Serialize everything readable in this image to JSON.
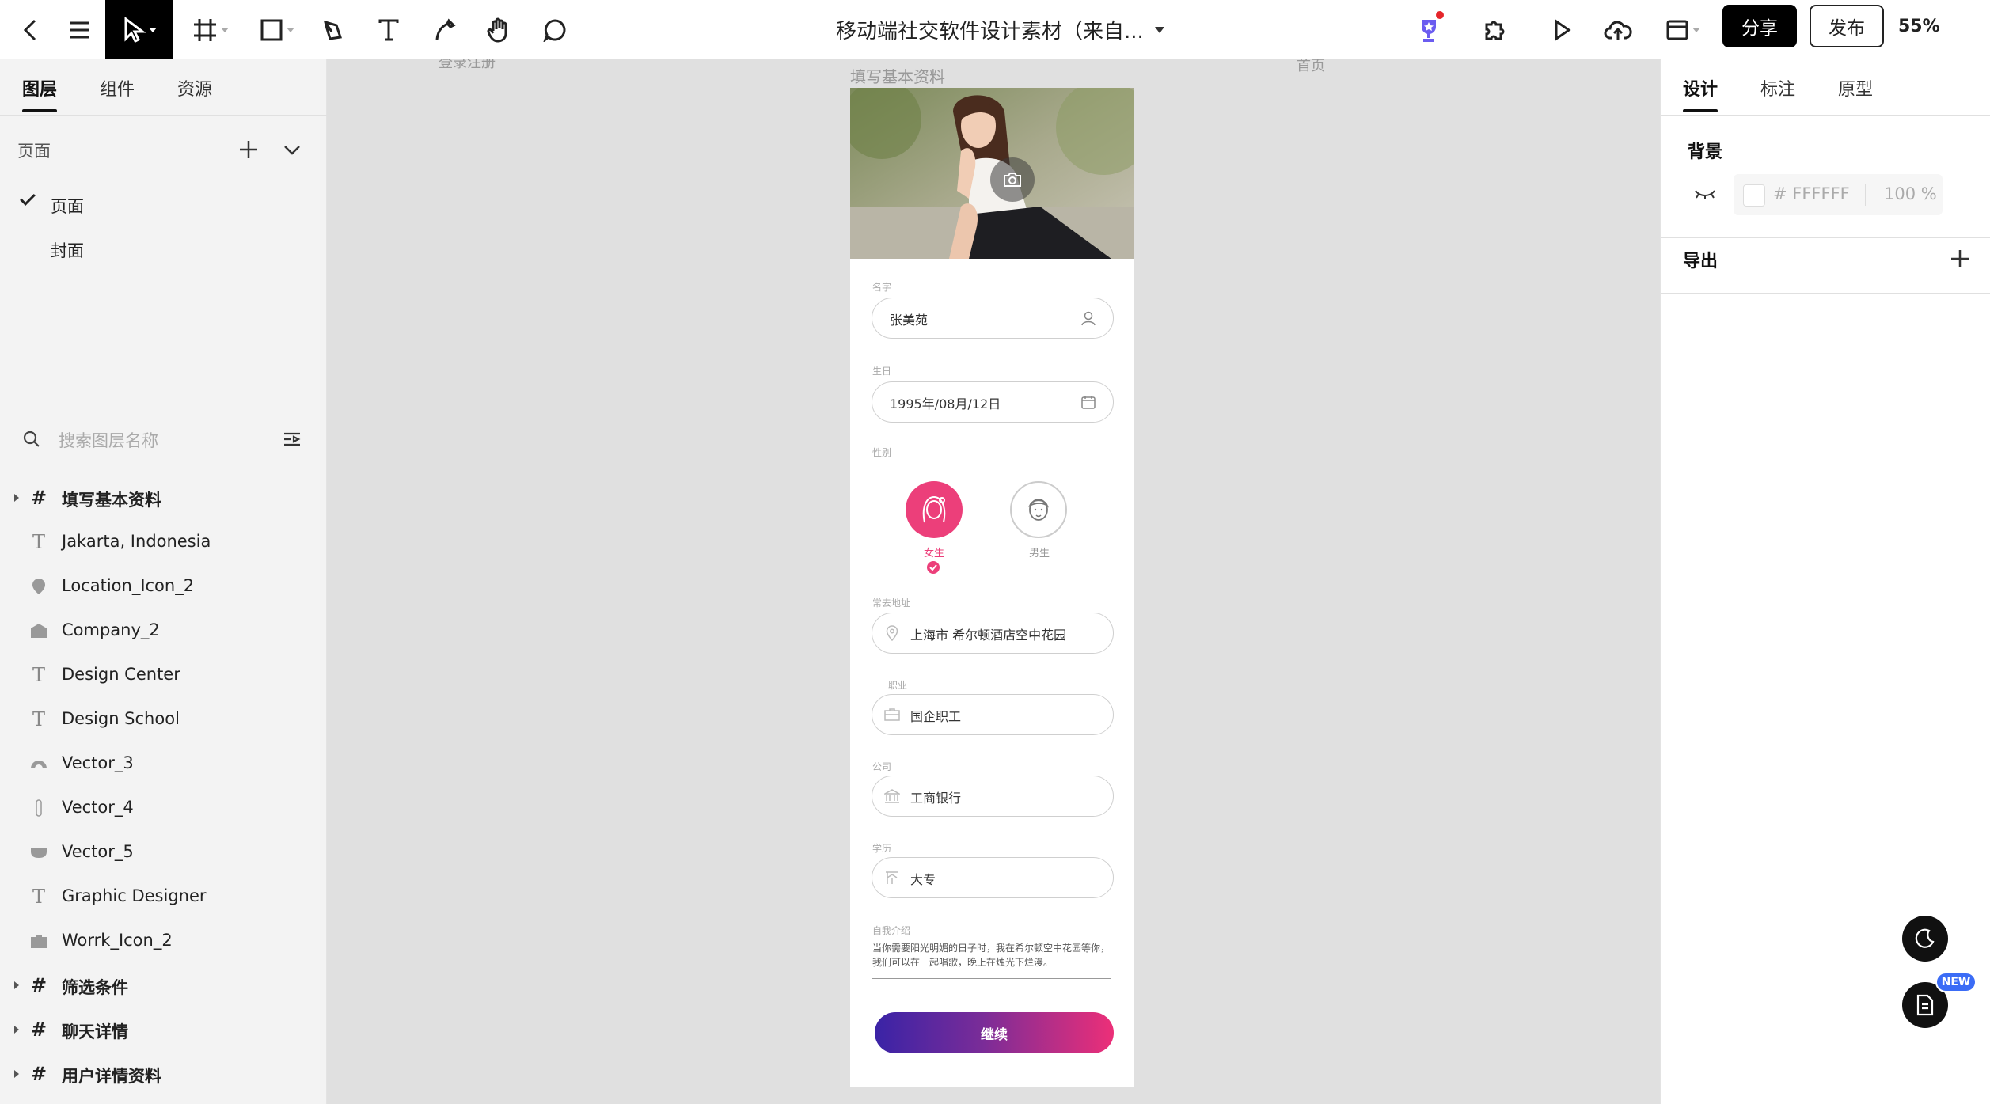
{
  "toolbar": {
    "title": "移动端社交软件设计素材（来自...",
    "share_label": "分享",
    "publish_label": "发布",
    "zoom": "55%"
  },
  "left_panel": {
    "tabs": [
      "图层",
      "组件",
      "资源"
    ],
    "pages_header": "页面",
    "pages": [
      "页面",
      "封面"
    ],
    "search_placeholder": "搜索图层名称",
    "layers": [
      {
        "name": "填写基本资料",
        "icon": "frame-icon"
      },
      {
        "name": "Jakarta, Indonesia",
        "icon": "text-icon"
      },
      {
        "name": "Location_Icon_2",
        "icon": "location-icon"
      },
      {
        "name": "Company_2",
        "icon": "company-icon"
      },
      {
        "name": "Design Center",
        "icon": "text-icon"
      },
      {
        "name": "Design School",
        "icon": "text-icon"
      },
      {
        "name": "Vector_3",
        "icon": "vector-icon"
      },
      {
        "name": "Vector_4",
        "icon": "vector-icon"
      },
      {
        "name": "Vector_5",
        "icon": "vector-icon"
      },
      {
        "name": "Graphic Designer",
        "icon": "text-icon"
      },
      {
        "name": "Worrk_Icon_2",
        "icon": "work-icon"
      },
      {
        "name": "筛选条件",
        "icon": "frame-icon"
      },
      {
        "name": "聊天详情",
        "icon": "frame-icon"
      },
      {
        "name": "用户详情资料",
        "icon": "frame-icon"
      }
    ]
  },
  "canvas": {
    "labels": {
      "left": "登录注册",
      "main": "填写基本资料",
      "right": "首页"
    },
    "form": {
      "name_label": "名字",
      "name_value": "张美苑",
      "birthday_label": "生日",
      "birthday_value": "1995年/08月/12日",
      "gender_label": "性别",
      "female": "女生",
      "male": "男生",
      "address_label": "常去地址",
      "address_value": "上海市 希尔顿酒店空中花园",
      "job_label": "职业",
      "job_value": "国企职工",
      "company_label": "公司",
      "company_value": "工商银行",
      "education_label": "学历",
      "education_value": "大专",
      "bio_label": "自我介绍",
      "bio_value": "当你需要阳光明媚的日子时，我在希尔顿空中花园等你，我们可以在一起唱歌，晚上在烛光下烂漫。",
      "continue_label": "继续"
    }
  },
  "right_panel": {
    "tabs": [
      "设计",
      "标注",
      "原型"
    ],
    "background_label": "背景",
    "bg_hex": "# FFFFFF",
    "bg_opacity": "100 %",
    "export_label": "导出"
  },
  "float": {
    "new_badge": "NEW"
  },
  "colors": {
    "accent_pink": "#ec3f7a",
    "cta_start": "#3a23a6",
    "cta_end": "#ec2f78"
  }
}
